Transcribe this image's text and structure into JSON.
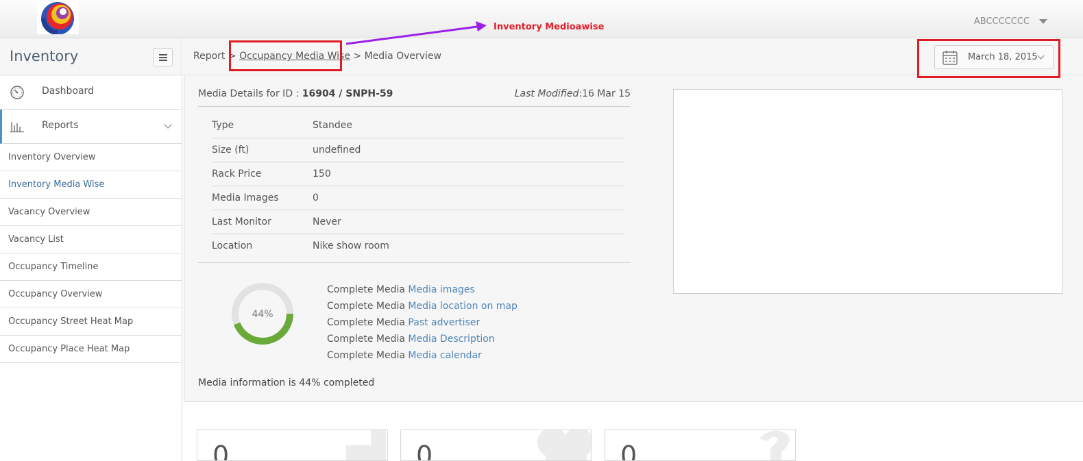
{
  "header": {
    "user_name": "ABCCCCCCC",
    "annotation_label": "Inventory Medioawise"
  },
  "sidebar": {
    "title": "Inventory",
    "dashboard_label": "Dashboard",
    "reports_label": "Reports",
    "report_items": [
      {
        "label": "Inventory Overview"
      },
      {
        "label": "Inventory Media Wise"
      },
      {
        "label": "Vacancy Overview"
      },
      {
        "label": "Vacancy List"
      },
      {
        "label": "Occupancy Timeline"
      },
      {
        "label": "Occupancy Overview"
      },
      {
        "label": "Occupancy Street Heat Map"
      },
      {
        "label": "Occupancy Place Heat Map"
      }
    ]
  },
  "breadcrumb": {
    "root": "Report",
    "sep1": ">",
    "middle": "Occupancy Media Wise",
    "sep2": ">",
    "current": "Media Overview"
  },
  "date_picker": {
    "value": "March 18, 2015"
  },
  "media_details": {
    "heading_prefix": "Media Details for ID :",
    "media_id": "16904 / SNPH-59",
    "modified_label": "Last Modified",
    "modified_value": ":16 Mar 15",
    "rows": [
      {
        "key": "Type",
        "value": "Standee"
      },
      {
        "key": "Size (ft)",
        "value": "undefined"
      },
      {
        "key": "Rack Price",
        "value": "150"
      },
      {
        "key": "Media Images",
        "value": "0"
      },
      {
        "key": "Last Monitor",
        "value": "Never"
      },
      {
        "key": "Location",
        "value": "Nike show room"
      }
    ]
  },
  "completion": {
    "percent": 44,
    "percent_label": "44%",
    "prefix": "Complete Media",
    "links": [
      {
        "label": "Media images"
      },
      {
        "label": "Media location on map"
      },
      {
        "label": "Past advertiser"
      },
      {
        "label": "Media Description"
      },
      {
        "label": "Media calendar"
      }
    ],
    "summary": "Media information is 44% completed",
    "ring_color": "#6aaa3a",
    "track_color": "#e2e2e2"
  },
  "stat_cards": [
    {
      "value": "0",
      "icon": "plus-icon"
    },
    {
      "value": "0",
      "icon": "heart-icon"
    },
    {
      "value": "0",
      "icon": "question-icon"
    }
  ],
  "colors": {
    "annotation_red": "#e01b24",
    "annotation_arrow": "#9b1fe8",
    "link_blue": "#4f86b8"
  }
}
